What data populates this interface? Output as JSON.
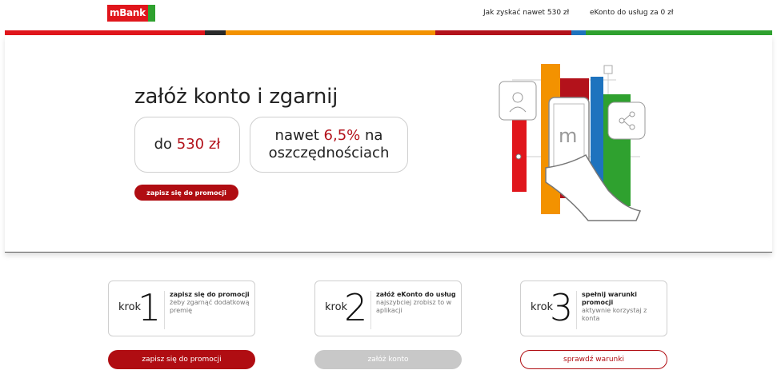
{
  "header": {
    "logo_text": "mBank",
    "nav": [
      "Jak zyskać nawet 530 zł",
      "eKonto do usług za 0 zł"
    ]
  },
  "hero": {
    "title": "załóż konto i zgarnij",
    "box1": {
      "pre": "do ",
      "highlight": "530 zł"
    },
    "box2": {
      "pre": "nawet ",
      "highlight": "6,5%",
      "post": " na",
      "line2": "oszczędnościach"
    },
    "button": "zapisz się do promocji"
  },
  "steps": [
    {
      "krok": "krok",
      "num": "1",
      "title": "zapisz się do promocji",
      "sub": "żeby zgarnąć dodatkową premię",
      "button": "zapisz się do promocji"
    },
    {
      "krok": "krok",
      "num": "2",
      "title": "załóż eKonto do usług",
      "sub": "najszybciej zrobisz to w aplikacji",
      "button": "załóż konto"
    },
    {
      "krok": "krok",
      "num": "3",
      "title": "spełnij warunki promocji",
      "sub": "aktywnie korzystaj z konta",
      "button": "sprawdź warunki"
    }
  ],
  "colors": {
    "brand_red": "#b00d12",
    "stripe": [
      "#e0161c",
      "#2a2a2a",
      "#f39200",
      "#b3121b",
      "#1e73be",
      "#2fa12f"
    ]
  },
  "icons": [
    "user-icon",
    "share-icon",
    "phone-icon",
    "hand-icon"
  ]
}
